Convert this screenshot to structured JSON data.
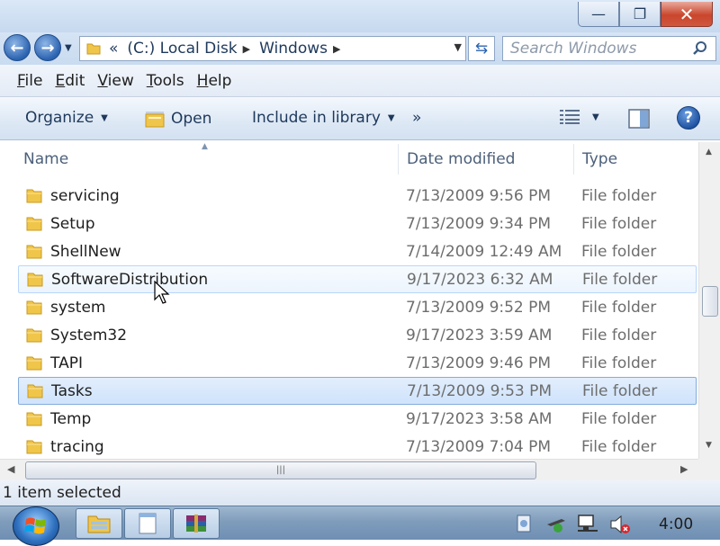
{
  "window": {
    "minimize_glyph": "—",
    "maximize_glyph": "❐",
    "close_glyph": "✕"
  },
  "address": {
    "overflow": "«",
    "crumbs": [
      "(C:) Local Disk",
      "Windows"
    ],
    "search_placeholder": "Search Windows"
  },
  "menu": {
    "items": [
      {
        "acc": "F",
        "rest": "ile"
      },
      {
        "acc": "E",
        "rest": "dit"
      },
      {
        "acc": "V",
        "rest": "iew"
      },
      {
        "acc": "T",
        "rest": "ools"
      },
      {
        "acc": "H",
        "rest": "elp"
      }
    ]
  },
  "toolbar": {
    "organize": "Organize",
    "open": "Open",
    "include": "Include in library",
    "more": "»",
    "help": "?"
  },
  "columns": {
    "name": "Name",
    "date": "Date modified",
    "type": "Type"
  },
  "files": [
    {
      "name": "servicing",
      "date": "7/13/2009 9:56 PM",
      "type": "File folder"
    },
    {
      "name": "Setup",
      "date": "7/13/2009 9:34 PM",
      "type": "File folder"
    },
    {
      "name": "ShellNew",
      "date": "7/14/2009 12:49 AM",
      "type": "File folder"
    },
    {
      "name": "SoftwareDistribution",
      "date": "9/17/2023 6:32 AM",
      "type": "File folder"
    },
    {
      "name": "system",
      "date": "7/13/2009 9:52 PM",
      "type": "File folder"
    },
    {
      "name": "System32",
      "date": "9/17/2023 3:59 AM",
      "type": "File folder"
    },
    {
      "name": "TAPI",
      "date": "7/13/2009 9:46 PM",
      "type": "File folder"
    },
    {
      "name": "Tasks",
      "date": "7/13/2009 9:53 PM",
      "type": "File folder"
    },
    {
      "name": "Temp",
      "date": "9/17/2023 3:58 AM",
      "type": "File folder"
    },
    {
      "name": "tracing",
      "date": "7/13/2009 7:04 PM",
      "type": "File folder"
    }
  ],
  "status": {
    "text": "1 item selected"
  },
  "taskbar": {
    "clock": "4:00"
  },
  "colors": {
    "folder": "#f0c64a",
    "selection": "#cfe3fc",
    "accent": "#2b63b0"
  }
}
